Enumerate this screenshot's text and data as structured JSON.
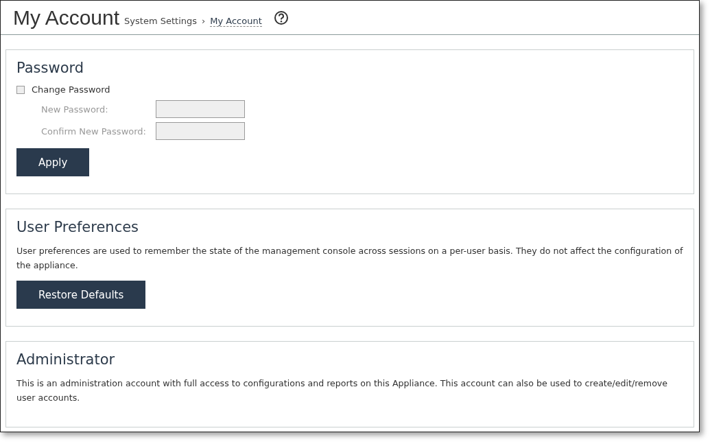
{
  "header": {
    "title": "My Account",
    "breadcrumb": {
      "separator": "›",
      "items": [
        {
          "label": "System Settings",
          "current": false
        },
        {
          "label": "My Account",
          "current": true
        }
      ]
    }
  },
  "password": {
    "heading": "Password",
    "change_password": {
      "label": "Change Password",
      "checked": false
    },
    "fields": [
      {
        "label": "New Password:",
        "disabled": true
      },
      {
        "label": "Confirm New Password:",
        "disabled": true
      }
    ],
    "button": "Apply"
  },
  "user_preferences": {
    "heading": "User Preferences",
    "description": "User preferences are used to remember the state of the management console across sessions on a per-user basis. They do not affect the configuration of the appliance.",
    "button": "Restore Defaults"
  },
  "administrator": {
    "heading": "Administrator",
    "description": "This is an administration account with full access to configurations and reports on this Appliance. This account can also be used to create/edit/remove user accounts."
  }
}
